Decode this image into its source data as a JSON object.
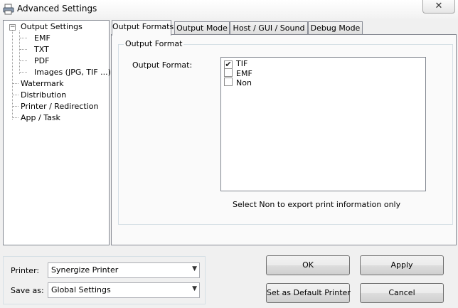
{
  "window": {
    "title": "Advanced Settings",
    "close_glyph": "✕"
  },
  "tree": {
    "root_label": "Output Settings",
    "expander_glyph": "−",
    "children": [
      "EMF",
      "TXT",
      "PDF",
      "Images (JPG, TIF ...)"
    ],
    "items": [
      "Watermark",
      "Distribution",
      "Printer / Redirection",
      "App / Task"
    ]
  },
  "tabs": [
    "Output Formats",
    "Output Mode",
    "Host /  GUI / Sound",
    "Debug Mode"
  ],
  "active_tab": 0,
  "output_format": {
    "group_title": "Output Format",
    "label": "Output Format:",
    "options": [
      {
        "label": "TIF",
        "checked": true
      },
      {
        "label": "EMF",
        "checked": false
      },
      {
        "label": "Non",
        "checked": false
      }
    ],
    "note": "Select Non to export print information only"
  },
  "bottom": {
    "printer_label": "Printer:",
    "printer_value": "Synergize Printer",
    "saveas_label": "Save as:",
    "saveas_value": "Global Settings"
  },
  "buttons": {
    "ok": "OK",
    "apply": "Apply",
    "set_default": "Set as Default Printer",
    "cancel": "Cancel"
  },
  "colors": {
    "check_mark": "#222222",
    "border": "#898c95"
  }
}
